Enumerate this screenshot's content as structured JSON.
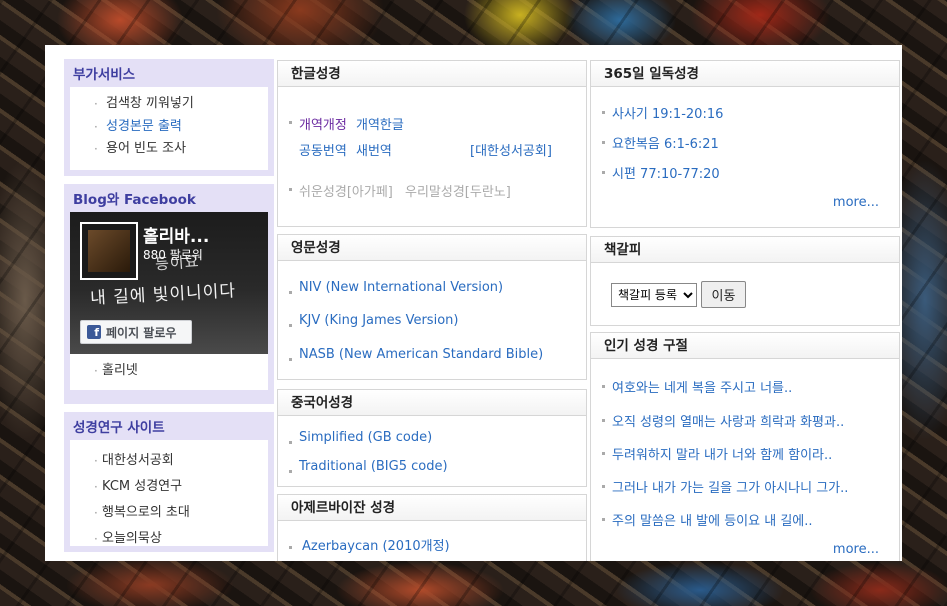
{
  "left": {
    "extra_services": {
      "title": "부가서비스",
      "items": [
        {
          "label": "검색창 끼워넣기"
        },
        {
          "label": "성경본문 출력"
        },
        {
          "label": "용어 빈도 조사"
        }
      ]
    },
    "social": {
      "title": "Blog와 Facebook",
      "fb_name": "홀리바...",
      "fb_followers": "880 팔로워",
      "fb_follow_label": "페이지 팔로우",
      "fb_logo": "f",
      "fb_image_text_1": "등이요",
      "fb_image_text_2": "내 길에 빛이니이다",
      "items": [
        {
          "label": "홀리넷"
        }
      ]
    },
    "research": {
      "title": "성경연구 사이트",
      "items": [
        {
          "label": "대한성서공회"
        },
        {
          "label": "KCM 성경연구"
        },
        {
          "label": "행복으로의 초대"
        },
        {
          "label": "오늘의묵상"
        }
      ]
    }
  },
  "korean": {
    "title": "한글성경",
    "v1": "개역개정",
    "v2": "개역한글",
    "v3": "공동번역",
    "v4": "새번역",
    "v5": "[대한성서공회]",
    "v6": "쉬운성경[아가페]",
    "v7": "우리말성경[두란노]"
  },
  "english": {
    "title": "영문성경",
    "items": [
      {
        "label": "NIV (New International Version)"
      },
      {
        "label": "KJV (King James Version)"
      },
      {
        "label": "NASB (New American Standard Bible)"
      }
    ]
  },
  "chinese": {
    "title": "중국어성경",
    "items": [
      {
        "label": "Simplified (GB code)"
      },
      {
        "label": "Traditional (BIG5 code)"
      }
    ]
  },
  "azerbaijani": {
    "title": "아제르바이잔 성경",
    "items": [
      {
        "label": "Azerbaycan (2010개정)"
      }
    ]
  },
  "daily": {
    "title": "365일 일독성경",
    "items": [
      {
        "label": "사사기 19:1-20:16"
      },
      {
        "label": "요한복음 6:1-6:21"
      },
      {
        "label": "시편 77:10-77:20"
      }
    ],
    "more": "more..."
  },
  "bookmark": {
    "title": "책갈피",
    "select_value": "책갈피 등록",
    "go_label": "이동"
  },
  "popular": {
    "title": "인기 성경 구절",
    "items": [
      {
        "label": "여호와는 네게 복을 주시고 너를.."
      },
      {
        "label": "오직 성령의 열매는 사랑과 희락과 화평과.."
      },
      {
        "label": "두려워하지 말라 내가 너와 함께 함이라.."
      },
      {
        "label": "그러나 내가 가는 길을 그가 아시나니 그가.."
      },
      {
        "label": "주의 말씀은 내 발에 등이요 내 길에.."
      }
    ],
    "more": "more..."
  }
}
